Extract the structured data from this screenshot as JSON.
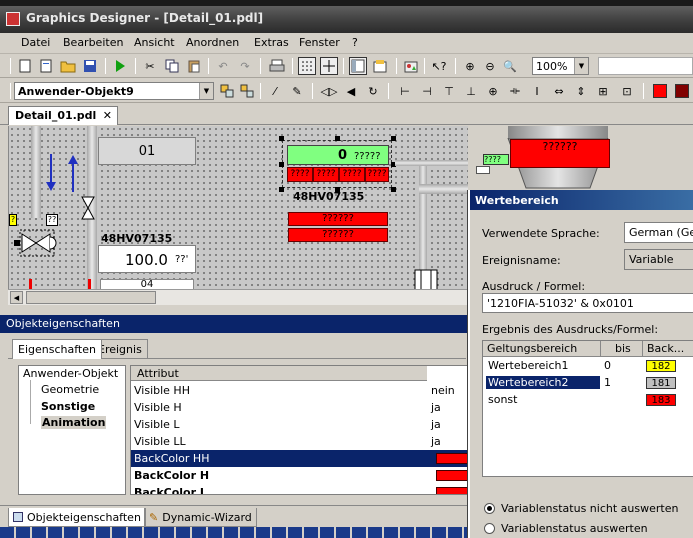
{
  "window": {
    "title": "Graphics Designer - [Detail_01.pdl]"
  },
  "menu": [
    "Datei",
    "Bearbeiten",
    "Ansicht",
    "Anordnen",
    "Extras",
    "Fenster",
    "?"
  ],
  "toolbar": {
    "zoom": "100%",
    "object_name": "Anwender-Objekt9"
  },
  "document_tab": {
    "label": "Detail_01.pdl",
    "close": "✕"
  },
  "canvas": {
    "field_01": "01",
    "value_zero": "0",
    "qmarks": "?????",
    "qmarks_short": "????",
    "qmarks_small": "??",
    "green_qmarks": "????",
    "tag_1": "48HV07135",
    "tag_2": "48HV07135",
    "value_100": "100.0",
    "unit_qm": "??'",
    "red_1": "??????",
    "red_2": "??????",
    "tank_label": "??????",
    "partial_04": "04"
  },
  "properties_panel": {
    "title": "Objekteigenschaften",
    "tabs": [
      "Eigenschaften",
      "Ereignis"
    ],
    "tree": [
      "Anwender-Objekt",
      "Geometrie",
      "Sonstige",
      "Animation"
    ],
    "attr_header": "Attribut",
    "rows": [
      {
        "name": "Visible HH",
        "value": "nein"
      },
      {
        "name": "Visible H",
        "value": "ja"
      },
      {
        "name": "Visible L",
        "value": "ja"
      },
      {
        "name": "Visible LL",
        "value": "ja"
      },
      {
        "name": "BackColor HH",
        "value": ""
      },
      {
        "name": "BackColor H",
        "value": ""
      },
      {
        "name": "BackColor L",
        "value": ""
      }
    ],
    "bottom_tabs": [
      "Objekteigenschaften",
      "Dynamic-Wizard"
    ]
  },
  "dialog": {
    "title": "Wertebereich",
    "language_label": "Verwendete Sprache:",
    "language_value": "German (Germany)",
    "event_label": "Ereignisname:",
    "event_value": "Variable",
    "expr_label": "Ausdruck / Formel:",
    "expr_value": "'1210FIA-51032' & 0x0101",
    "result_label": "Ergebnis des Ausdrucks/Formel:",
    "table_headers": [
      "Geltungsbereich",
      "bis",
      "Back..."
    ],
    "ranges": [
      {
        "name": "Wertebereich1",
        "bis": "0",
        "color_code": "182",
        "color": "#ffff00"
      },
      {
        "name": "Wertebereich2",
        "bis": "1",
        "color_code": "181",
        "color": "#c0c0c0"
      },
      {
        "name": "sonst",
        "bis": "",
        "color_code": "183",
        "color": "#ff0000"
      }
    ],
    "radio_1": "Variablenstatus nicht auswerten",
    "radio_2": "Variablenstatus auswerten"
  },
  "colors": {
    "selection": "#0a246a",
    "alarm_red": "#ff0000",
    "ok_green": "#80ff80"
  }
}
